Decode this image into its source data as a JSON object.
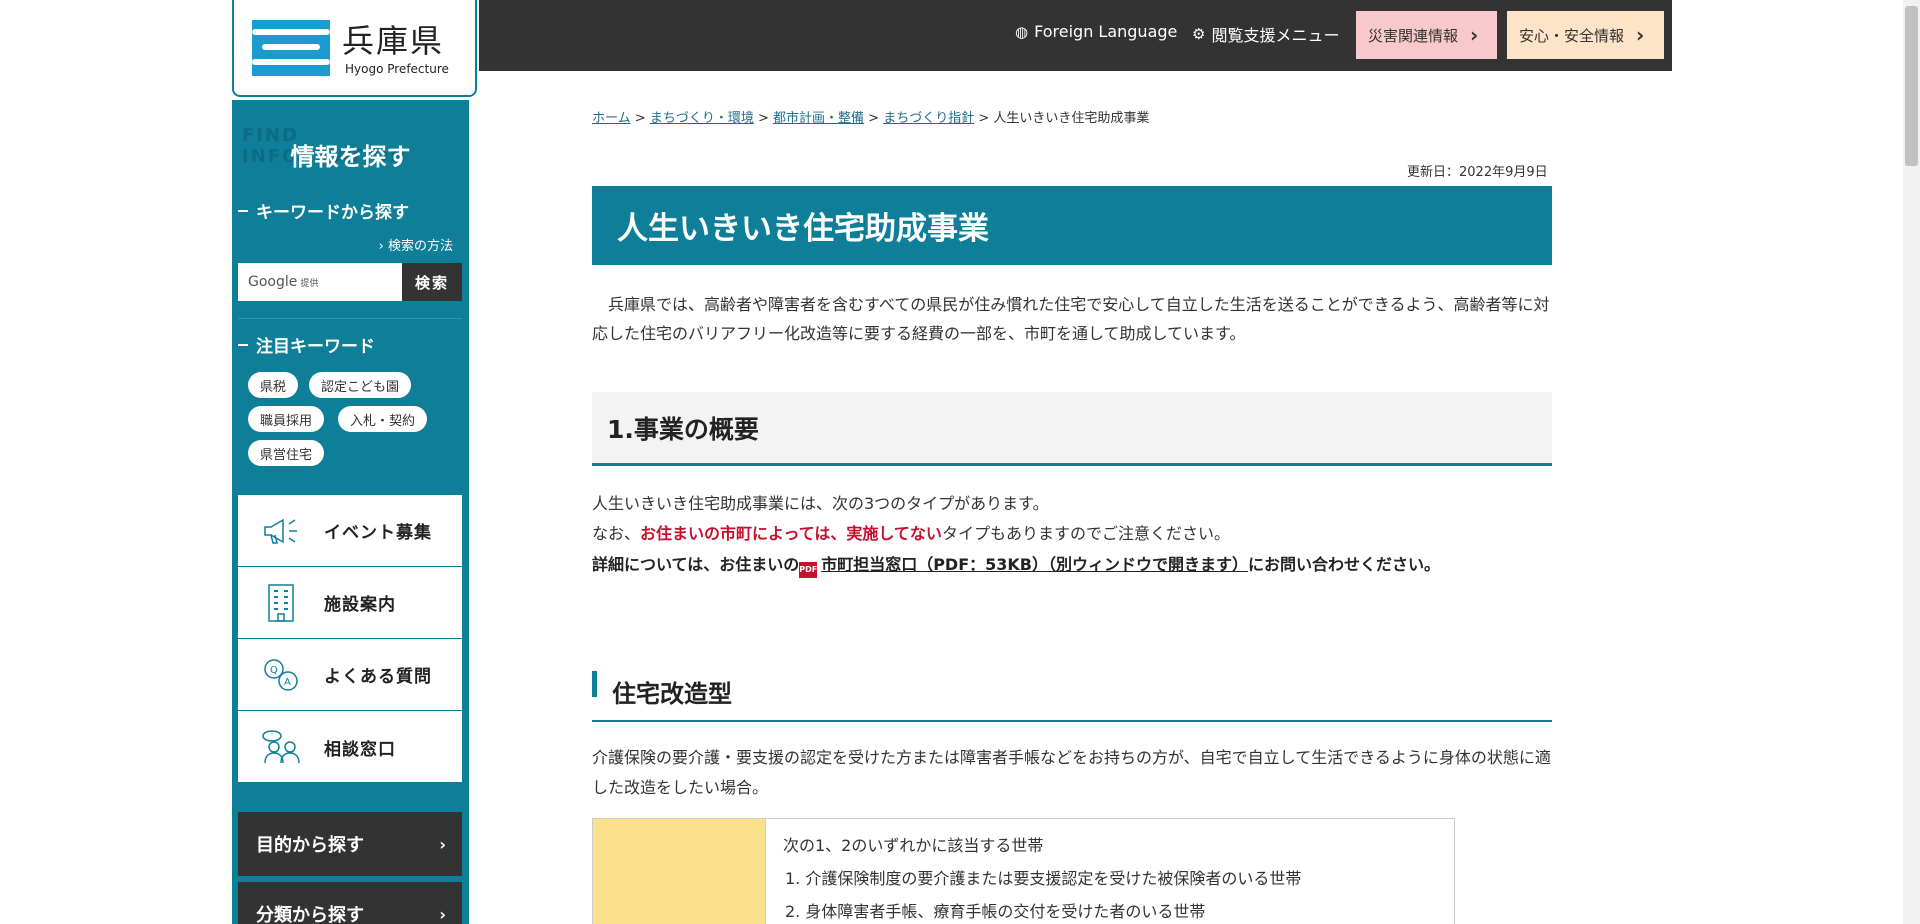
{
  "header": {
    "logo_title": "兵庫県",
    "logo_subtitle": "Hyogo Prefecture",
    "foreign_language": "Foreign Language",
    "accessibility_menu": "閲覧支援メニュー",
    "disaster_info": "災害関連情報",
    "safety_info": "安心・安全情報"
  },
  "sidebar": {
    "find_bg": "FIND INFORMATION",
    "find_title": "情報を探す",
    "keyword_title": "キーワードから探す",
    "search_howto": "検索の方法",
    "search_provider": "Google",
    "search_provider_note": "提供",
    "search_button": "検索",
    "featured_title": "注目キーワード",
    "tags": [
      "県税",
      "認定こども園",
      "職員採用",
      "入札・契約",
      "県営住宅"
    ],
    "menu": [
      "イベント募集",
      "施設案内",
      "よくある質問",
      "相談窓口"
    ],
    "purpose_button": "目的から探す",
    "category_button": "分類から探す"
  },
  "breadcrumb": {
    "items": [
      "ホーム",
      "まちづくり・環境",
      "都市計画・整備",
      "まちづくり指針"
    ],
    "current": "人生いきいき住宅助成事業",
    "separator": ">"
  },
  "main": {
    "updated": "更新日：2022年9月9日",
    "title": "人生いきいき住宅助成事業",
    "intro": "兵庫県では、高齢者や障害者を含むすべての県民が住み慣れた住宅で安心して自立した生活を送ることができるよう、高齢者等に対応した住宅のバリアフリー化改造等に要する経費の一部を、市町を通して助成しています。",
    "section1_title": "1.事業の概要",
    "p1": "人生いきいき住宅助成事業には、次の3つのタイプがあります。",
    "p2_pre": "なお、",
    "p2_red": "お住まいの市町によっては、実施してない",
    "p2_post": "タイプもありますのでご注意ください。",
    "p3_pre": "詳細については、お住まいの",
    "pdf_badge": "PDF",
    "p3_link": "市町担当窓口（PDF：53KB）（別ウィンドウで開きます）",
    "p3_post": "にお問い合わせください。",
    "section2_title": "住宅改造型",
    "p4": "介護保険の要介護・要支援の認定を受けた方または障害者手帳などをお持ちの方が、自宅で自立して生活できるように身体の状態に適した改造をしたい場合。",
    "table_line1": "次の1、2のいずれかに該当する世帯",
    "table_line2": "1. 介護保険制度の要介護または要支援認定を受けた被保険者のいる世帯",
    "table_line3": "2. 身体障害者手帳、療育手帳の交付を受けた者のいる世帯"
  }
}
